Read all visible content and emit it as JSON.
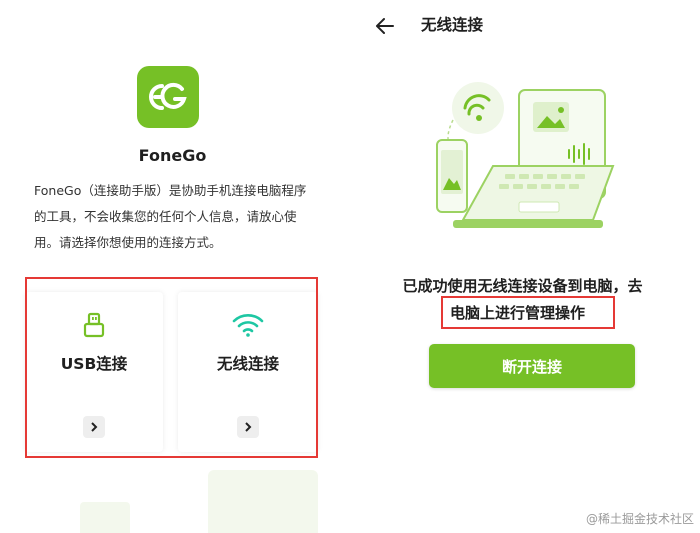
{
  "colors": {
    "accent": "#76c026",
    "highlight_box": "#e53935"
  },
  "home": {
    "app_name": "FoneGo",
    "description": "FoneGo（连接助手版）是协助手机连接电脑程序的工具，不会收集您的任何个人信息，请放心使用。请选择你想使用的连接方式。",
    "options": [
      {
        "label": "USB连接",
        "icon": "usb-icon"
      },
      {
        "label": "无线连接",
        "icon": "wifi-icon"
      }
    ]
  },
  "wireless": {
    "title": "无线连接",
    "status_line1": "已成功使用无线连接设备到电脑，去",
    "status_line2": "电脑上进行管理操作",
    "disconnect_label": "断开连接"
  },
  "watermark": "@稀土掘金技术社区"
}
